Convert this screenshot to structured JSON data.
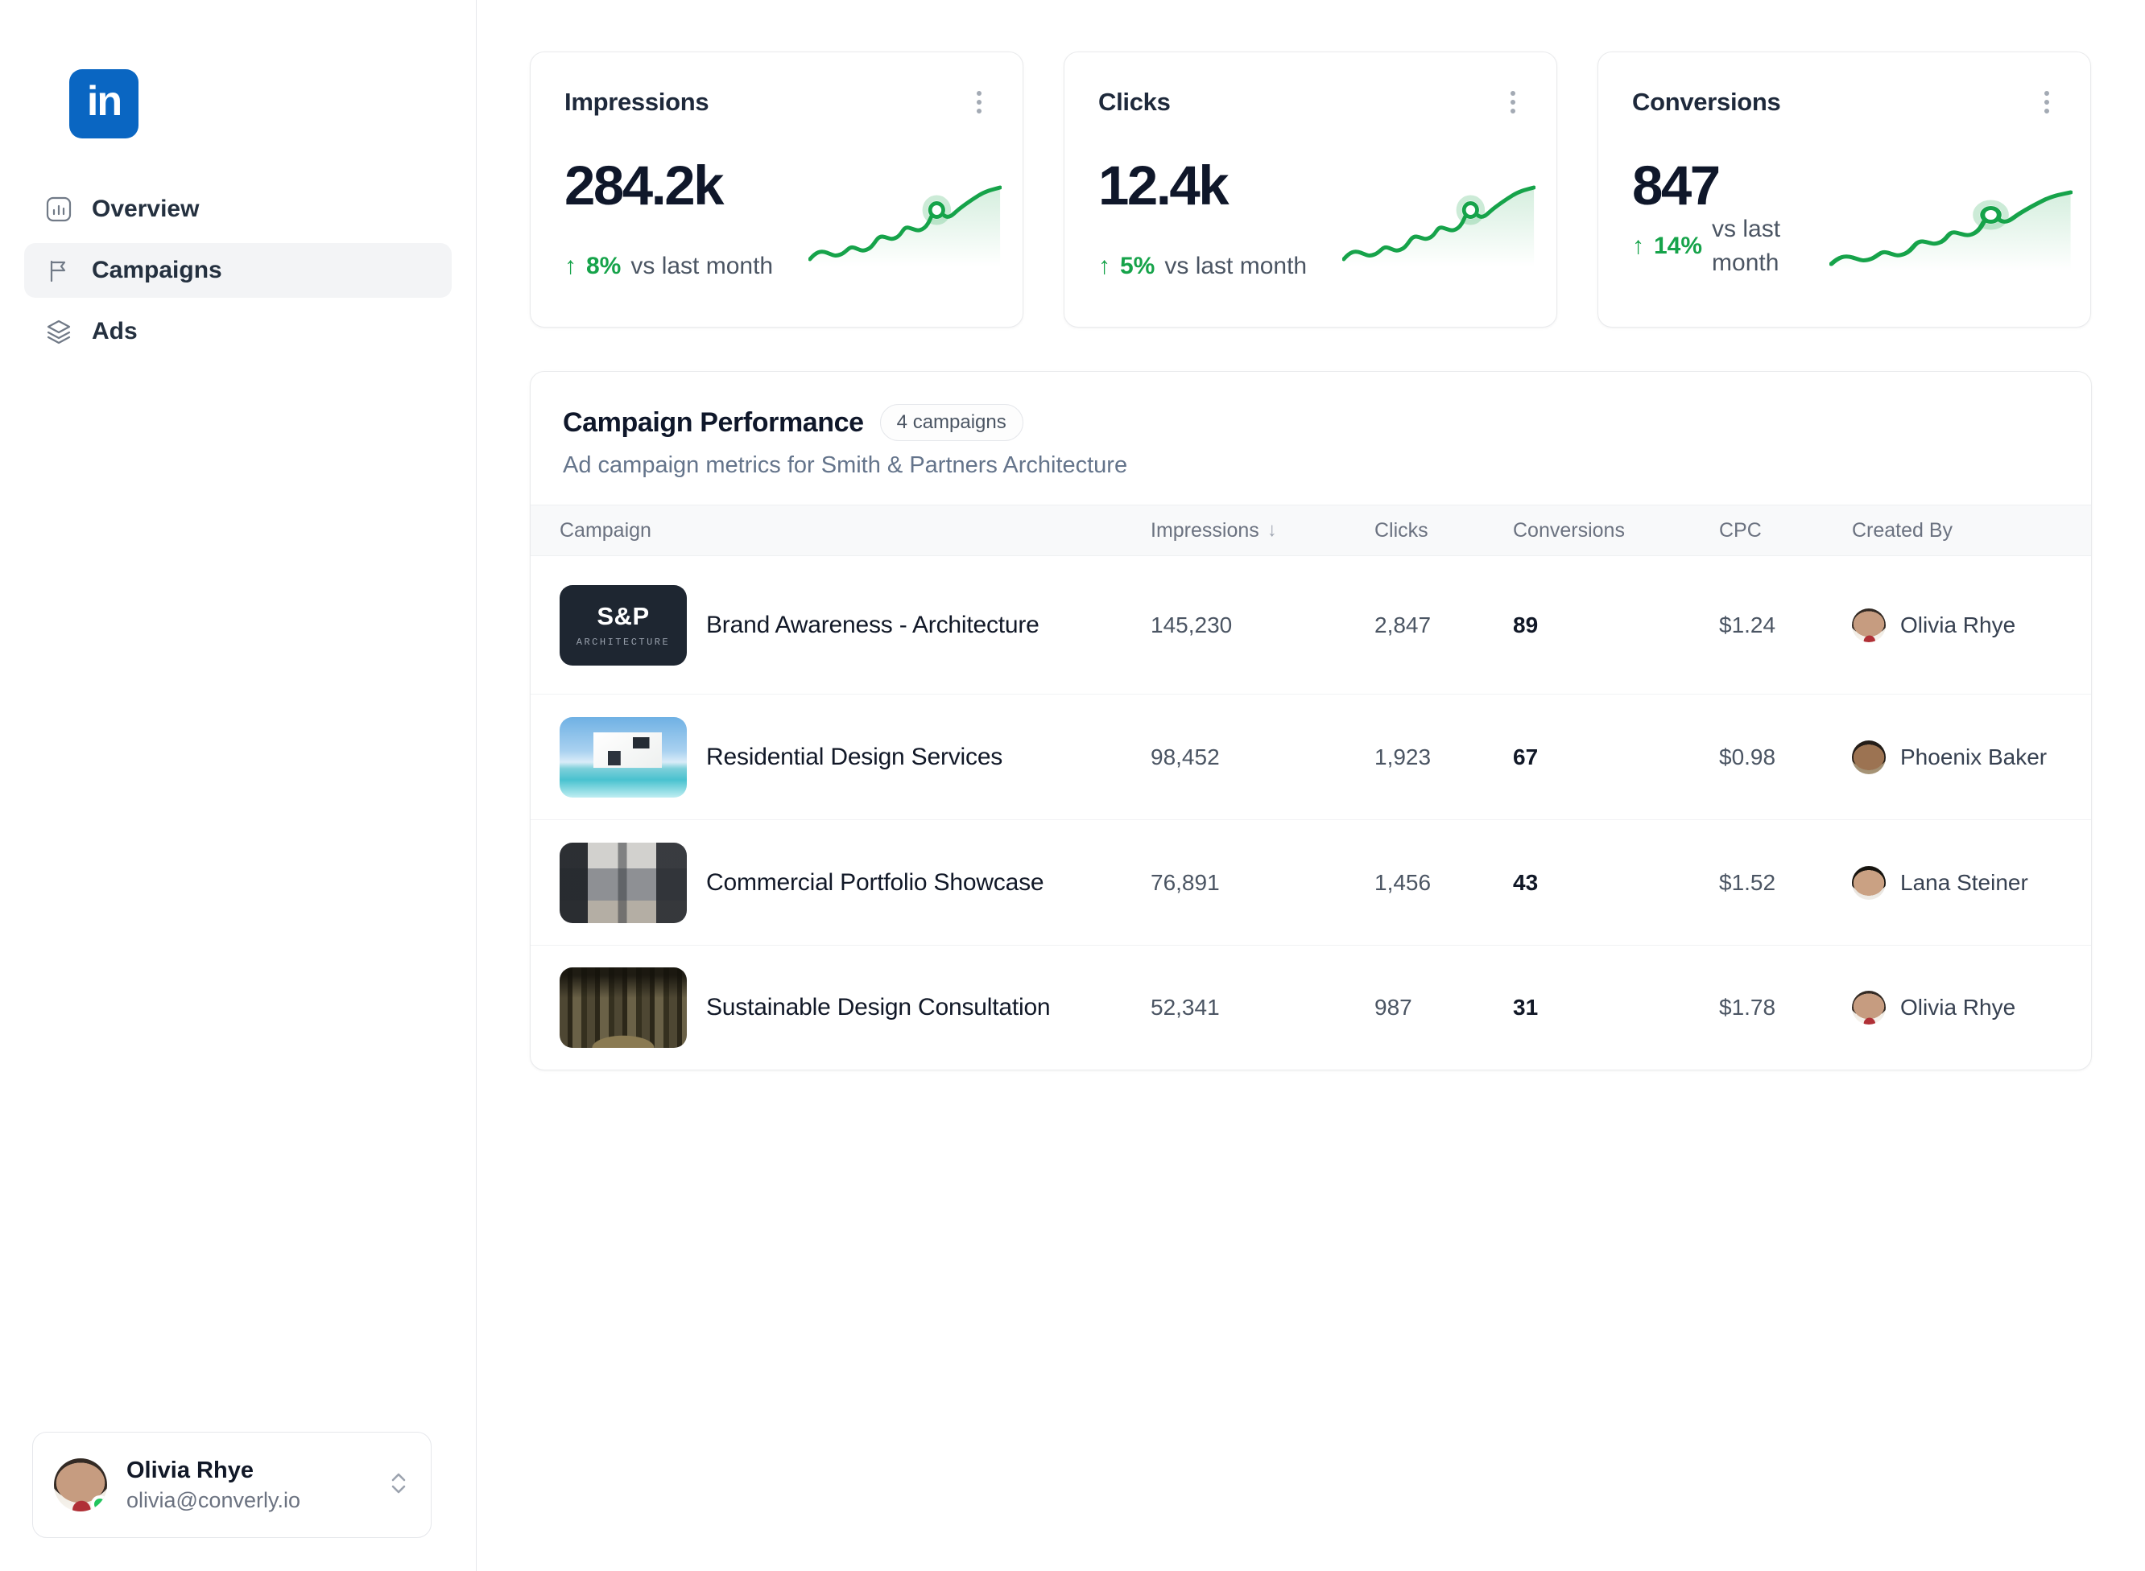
{
  "brand": {
    "logo_text": "in",
    "color": "#0a66c2"
  },
  "icons": {
    "trend_up": "↑",
    "sort_desc": "↓"
  },
  "colors": {
    "accent_green": "#16a34a",
    "linkedin_blue": "#0a66c2",
    "text_dark": "#0f172a",
    "text_gray": "#64748b",
    "border": "#e5e7eb",
    "header_bg": "#f8f9fa"
  },
  "sidebar": {
    "nav": [
      {
        "label": "Overview"
      },
      {
        "label": "Campaigns"
      },
      {
        "label": "Ads"
      }
    ],
    "user": {
      "name": "Olivia Rhye",
      "email": "olivia@converly.io",
      "status": "online"
    }
  },
  "stats": [
    {
      "title": "Impressions",
      "value": "284.2k",
      "delta": "8%",
      "caption": "vs last month",
      "trend": "up"
    },
    {
      "title": "Clicks",
      "value": "12.4k",
      "delta": "5%",
      "caption": "vs last month",
      "trend": "up"
    },
    {
      "title": "Conversions",
      "value": "847",
      "delta": "14%",
      "caption": "vs last month",
      "trend": "up"
    }
  ],
  "performance": {
    "title": "Campaign Performance",
    "badge": "4 campaigns",
    "subtitle": "Ad campaign metrics for Smith & Partners Architecture",
    "columns": [
      "Campaign",
      "Impressions",
      "Clicks",
      "Conversions",
      "CPC",
      "Created By"
    ],
    "sort": {
      "column": "Impressions",
      "direction": "desc"
    },
    "rows": [
      {
        "thumb": {
          "title": "S&P",
          "subtitle": "ARCHITECTURE"
        },
        "campaign": "Brand Awareness - Architecture",
        "impressions": "145,230",
        "clicks": "2,847",
        "conversions": "89",
        "cpc": "$1.24",
        "created_by": "Olivia Rhye"
      },
      {
        "campaign": "Residential Design Services",
        "impressions": "98,452",
        "clicks": "1,923",
        "conversions": "67",
        "cpc": "$0.98",
        "created_by": "Phoenix Baker"
      },
      {
        "campaign": "Commercial Portfolio Showcase",
        "impressions": "76,891",
        "clicks": "1,456",
        "conversions": "43",
        "cpc": "$1.52",
        "created_by": "Lana Steiner"
      },
      {
        "campaign": "Sustainable Design Consultation",
        "impressions": "52,341",
        "clicks": "987",
        "conversions": "31",
        "cpc": "$1.78",
        "created_by": "Olivia Rhye"
      }
    ]
  }
}
